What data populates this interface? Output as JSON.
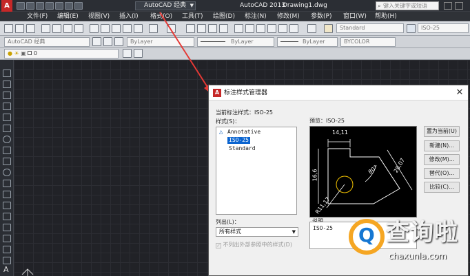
{
  "title_bar": {
    "workspace": "AutoCAD 经典",
    "app_name": "AutoCAD 2013",
    "doc_name": "Drawing1.dwg",
    "search_placeholder": "键入关键字或短语"
  },
  "menu": [
    "文件(F)",
    "编辑(E)",
    "视图(V)",
    "插入(I)",
    "格式(O)",
    "工具(T)",
    "绘图(D)",
    "标注(N)",
    "修改(M)",
    "参数(P)",
    "窗口(W)",
    "帮助(H)"
  ],
  "toolbar": {
    "text_style": "Standard",
    "dim_style": "ISO-25",
    "workspace_combo": "AutoCAD 经典",
    "color": "ByLayer",
    "linetype": "ByLayer",
    "lineweight": "ByLayer",
    "plotstyle": "BYCOLOR",
    "layer": "0"
  },
  "dialog": {
    "title": "标注样式管理器",
    "current_label": "当前标注样式：ISO-25",
    "styles_label": "样式(S)：",
    "styles": [
      "Annotative",
      "ISO-25",
      "Standard"
    ],
    "selected_style": "ISO-25",
    "preview_label": "预览：ISO-25",
    "list_label": "列出(L)：",
    "list_value": "所有样式",
    "exclude_label": "不列出外部参照中的样式(D)",
    "desc_label": "说明",
    "desc_value": "ISO-25",
    "buttons": {
      "set_current": "置为当前(U)",
      "new": "新建(N)...",
      "modify": "修改(M)...",
      "override": "替代(O)...",
      "compare": "比较(C)..."
    },
    "preview_dims": {
      "top": "14,11",
      "left": "16,6",
      "right": "28,07",
      "angle": "80°",
      "radius": "R11,17"
    }
  },
  "watermark": {
    "icon_letter": "Q",
    "text": "查询啦",
    "url": "chaxunla.com"
  },
  "colors": {
    "canvas": "#212227",
    "accent_arrow": "#e53935",
    "selected": "#0a64d0",
    "watermark_orange": "#f5a623"
  }
}
